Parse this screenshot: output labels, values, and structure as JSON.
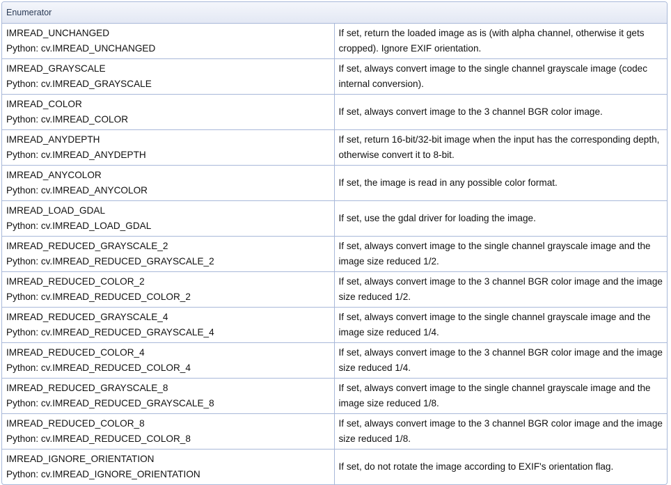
{
  "table": {
    "header": "Enumerator",
    "rows": [
      {
        "name": "IMREAD_UNCHANGED",
        "python": "Python: cv.IMREAD_UNCHANGED",
        "desc": "If set, return the loaded image as is (with alpha channel, otherwise it gets cropped). Ignore EXIF orientation."
      },
      {
        "name": "IMREAD_GRAYSCALE",
        "python": "Python: cv.IMREAD_GRAYSCALE",
        "desc": "If set, always convert image to the single channel grayscale image (codec internal conversion)."
      },
      {
        "name": "IMREAD_COLOR",
        "python": "Python: cv.IMREAD_COLOR",
        "desc": "If set, always convert image to the 3 channel BGR color image."
      },
      {
        "name": "IMREAD_ANYDEPTH",
        "python": "Python: cv.IMREAD_ANYDEPTH",
        "desc": "If set, return 16-bit/32-bit image when the input has the corresponding depth, otherwise convert it to 8-bit."
      },
      {
        "name": "IMREAD_ANYCOLOR",
        "python": "Python: cv.IMREAD_ANYCOLOR",
        "desc": "If set, the image is read in any possible color format."
      },
      {
        "name": "IMREAD_LOAD_GDAL",
        "python": "Python: cv.IMREAD_LOAD_GDAL",
        "desc": "If set, use the gdal driver for loading the image."
      },
      {
        "name": "IMREAD_REDUCED_GRAYSCALE_2",
        "python": "Python: cv.IMREAD_REDUCED_GRAYSCALE_2",
        "desc": "If set, always convert image to the single channel grayscale image and the image size reduced 1/2."
      },
      {
        "name": "IMREAD_REDUCED_COLOR_2",
        "python": "Python: cv.IMREAD_REDUCED_COLOR_2",
        "desc": "If set, always convert image to the 3 channel BGR color image and the image size reduced 1/2."
      },
      {
        "name": "IMREAD_REDUCED_GRAYSCALE_4",
        "python": "Python: cv.IMREAD_REDUCED_GRAYSCALE_4",
        "desc": "If set, always convert image to the single channel grayscale image and the image size reduced 1/4."
      },
      {
        "name": "IMREAD_REDUCED_COLOR_4",
        "python": "Python: cv.IMREAD_REDUCED_COLOR_4",
        "desc": "If set, always convert image to the 3 channel BGR color image and the image size reduced 1/4."
      },
      {
        "name": "IMREAD_REDUCED_GRAYSCALE_8",
        "python": "Python: cv.IMREAD_REDUCED_GRAYSCALE_8",
        "desc": "If set, always convert image to the single channel grayscale image and the image size reduced 1/8."
      },
      {
        "name": "IMREAD_REDUCED_COLOR_8",
        "python": "Python: cv.IMREAD_REDUCED_COLOR_8",
        "desc": "If set, always convert image to the 3 channel BGR color image and the image size reduced 1/8."
      },
      {
        "name": "IMREAD_IGNORE_ORIENTATION",
        "python": "Python: cv.IMREAD_IGNORE_ORIENTATION",
        "desc": "If set, do not rotate the image according to EXIF's orientation flag."
      }
    ]
  },
  "colors": {
    "border": "#a8b8d9",
    "header_bg": "#e3e8f4",
    "text": "#111111"
  }
}
